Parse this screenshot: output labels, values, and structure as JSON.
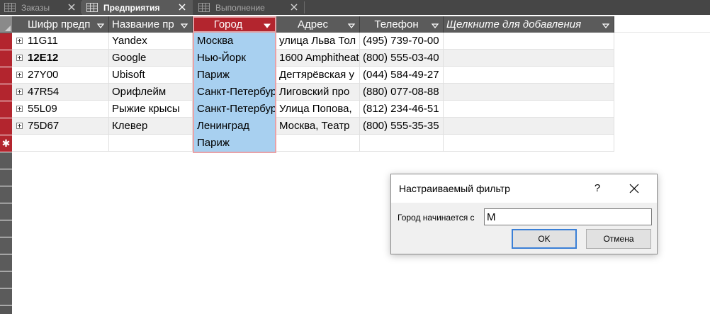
{
  "tabs": [
    {
      "label": "Заказы",
      "active": false
    },
    {
      "label": "Предприятия",
      "active": true
    },
    {
      "label": "Выполнение",
      "active": false
    }
  ],
  "columns": [
    {
      "label": "Шифр предп",
      "key": "code"
    },
    {
      "label": "Название пр",
      "key": "name"
    },
    {
      "label": "Город",
      "key": "city"
    },
    {
      "label": "Адрес",
      "key": "address"
    },
    {
      "label": "Телефон",
      "key": "phone"
    },
    {
      "label": "Щелкните для добавления",
      "key": "add"
    }
  ],
  "rows": [
    {
      "code": "11G11",
      "name": "Yandex",
      "city": "Москва",
      "address": "улица Льва Тол",
      "phone": "(495) 739-70-00"
    },
    {
      "code": "12E12",
      "name": "Google",
      "city": "Нью-Йорк",
      "address": "1600 Amphitheat",
      "phone": "(800) 555-03-40"
    },
    {
      "code": "27Y00",
      "name": "Ubisoft",
      "city": "Париж",
      "address": "Дегтярёвская у",
      "phone": "(044) 584-49-27"
    },
    {
      "code": "47R54",
      "name": "Орифлейм",
      "city": "Санкт-Петербург",
      "address": "Лиговский про",
      "phone": "(880) 077-08-88"
    },
    {
      "code": "55L09",
      "name": "Рыжие крысы",
      "city": "Санкт-Петербург",
      "address": "Улица Попова,",
      "phone": "(812) 234-46-51"
    },
    {
      "code": "75D67",
      "name": "Клевер",
      "city": "Ленинград",
      "address": " Москва, Театр",
      "phone": "(800) 555-35-35"
    }
  ],
  "new_row": {
    "marker": "✱",
    "city": "Париж"
  },
  "dialog": {
    "title": "Настраиваемый фильтр",
    "help": "?",
    "label": "Город начинается с",
    "value": "М",
    "ok_label": "OK",
    "cancel_label": "Отмена"
  },
  "colors": {
    "accent_red": "#b3252e",
    "city_highlight": "#a8d0f0",
    "header_gray": "#5b5b5b",
    "dialog_focus": "#3a7fd6"
  }
}
